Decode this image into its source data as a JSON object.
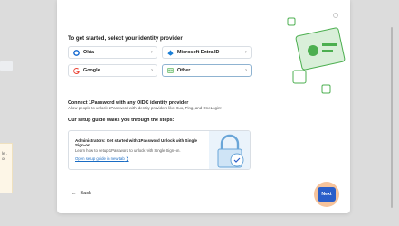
{
  "left": {
    "panel_text": "le\n, or"
  },
  "main": {
    "title": "To get started, select your identity provider",
    "providers": [
      {
        "label": "Okta",
        "icon": "okta-icon"
      },
      {
        "label": "Microsoft Entra ID",
        "icon": "microsoft-entra-icon"
      },
      {
        "label": "Google",
        "icon": "google-icon"
      },
      {
        "label": "Other",
        "icon": "other-id-card-icon"
      }
    ],
    "oidc_title": "Connect 1Password with any OIDC identity provider",
    "oidc_sub": "Allow people to unlock 1Password with identity providers like Duo, Ping, and OneLogin!",
    "guide_title": "Our setup guide walks you through the steps:",
    "card": {
      "title": "Administrators: Get started with 1Password Unlock with Single Sign-on",
      "desc": "Learn how to setup 1Password to unlock with Single Sign-on.",
      "link": "Open setup guide in new tab"
    },
    "back_label": "Back",
    "next_label": "Next"
  },
  "colors": {
    "accent": "#2a5ec9",
    "illustration": "#4caf50",
    "highlight": "#f4b98a"
  }
}
